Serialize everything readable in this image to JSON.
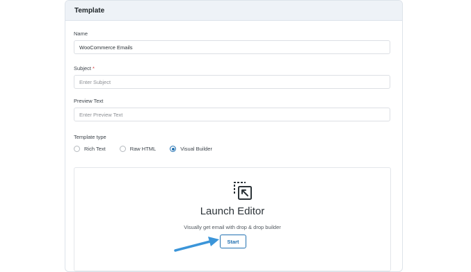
{
  "panel": {
    "title": "Template"
  },
  "fields": {
    "name": {
      "label": "Name",
      "value": "WooCommerce Emails"
    },
    "subject": {
      "label": "Subject",
      "required_mark": "*",
      "placeholder": "Enter Subject"
    },
    "preview": {
      "label": "Preview Text",
      "placeholder": "Enter Preview Text"
    }
  },
  "template_type": {
    "label": "Template type",
    "options": [
      "Rich Text",
      "Raw HTML",
      "Visual Builder"
    ],
    "selected": "Visual Builder"
  },
  "editor": {
    "icon": "launch-editor-icon",
    "title": "Launch Editor",
    "description": "Visually get email with drop & drop builder",
    "start_label": "Start"
  },
  "colors": {
    "accent": "#2271b1",
    "arrow": "#3b95d9"
  }
}
